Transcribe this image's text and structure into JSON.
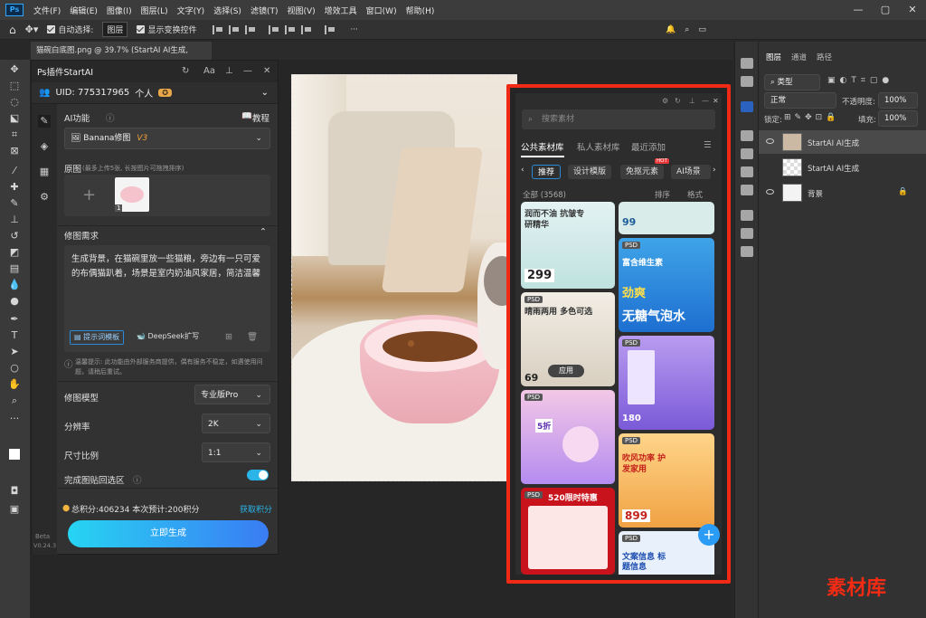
{
  "menubar": {
    "logo": "Ps",
    "items": [
      "文件(F)",
      "编辑(E)",
      "图像(I)",
      "图层(L)",
      "文字(Y)",
      "选择(S)",
      "滤镜(T)",
      "视图(V)",
      "增效工具",
      "窗口(W)",
      "帮助(H)"
    ]
  },
  "options": {
    "auto_select": "自动选择:",
    "layer": "图层",
    "show_transform": "显示变换控件"
  },
  "document": {
    "tab_title": "猫碗白底图.png @ 39.7% (StartAI AI生成, RGB/8) *"
  },
  "startai": {
    "title": "Ps插件StartAI",
    "uid_label": "UID: 775317965",
    "account": "个人",
    "ai_function": "AI功能",
    "tutorial": "教程",
    "model_name": "Banana修图",
    "model_version": "V3",
    "original": "原图",
    "original_hint": "(最多上传5张, 长按图片可拖拽排序)",
    "thumb_count": "1",
    "requirement": "修图需求",
    "prompt": "生成背景，在猫碗里放一些猫粮，旁边有一只可爱的布偶猫趴着，场景是室内奶油风家居，简洁温馨",
    "prompt_template": "提示词模板",
    "deepseek": "DeepSeek扩写",
    "notice": "温馨提示: 此功能由外部服务商提供，偶有服务不稳定，如遇使用问题，请稍后重试。",
    "model_label": "修图模型",
    "model_value": "专业版Pro",
    "resolution_label": "分辨率",
    "resolution_value": "2K",
    "ratio_label": "尺寸比例",
    "ratio_value": "1:1",
    "paste_back": "完成图贴回选区",
    "points": "总积分:406234  本次预计:200积分",
    "get_points": "获取积分",
    "generate": "立即生成",
    "beta": "Beta",
    "version": "V0.24.3"
  },
  "library": {
    "search_placeholder": "搜索素材",
    "tabs": [
      "公共素材库",
      "私人素材库",
      "最近添加"
    ],
    "categories": [
      "推荐",
      "设计模版",
      "免抠元素",
      "AI场景"
    ],
    "hot": "HOT",
    "all_label": "全部 (3568)",
    "sort": "排序",
    "format": "格式",
    "apply": "应用",
    "cards": {
      "c1": "润而不油 抗皱专研精华",
      "c1_price": "299",
      "c2": "晴雨两用 多色可选",
      "c2_price": "69",
      "c3": "富含维生素",
      "c3b": "劲爽",
      "c3c": "无糖气泡水",
      "c4_price": "180",
      "c5_price": "5折",
      "c6": "吹风功率 护发家用",
      "c6_price": "899",
      "c7": "520限时特惠",
      "c8": "文案信息 标题信息"
    }
  },
  "layers": {
    "tabs": [
      "图层",
      "通道",
      "路径"
    ],
    "kind": "类型",
    "blend": "正常",
    "opacity_label": "不透明度:",
    "opacity": "100%",
    "lock_label": "锁定:",
    "fill_label": "填充:",
    "fill": "100%",
    "rows": [
      "StartAI AI生成",
      "StartAI AI生成",
      "背景"
    ]
  },
  "watermark": "素材库"
}
